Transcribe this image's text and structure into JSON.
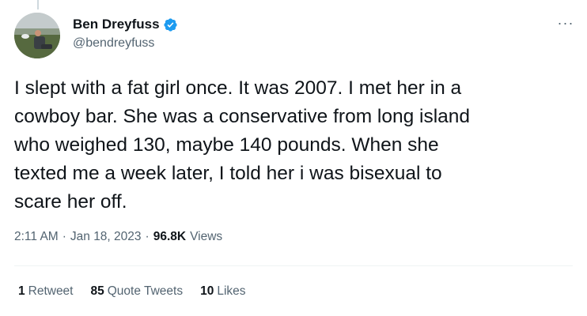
{
  "author": {
    "display_name": "Ben Dreyfuss",
    "handle": "@bendreyfuss",
    "verified_icon": "verified-badge-icon",
    "verified_color": "#1d9bf0"
  },
  "menu": {
    "more_label": "···"
  },
  "tweet": {
    "text": "I slept with a fat girl once. It was 2007. I met her in a\ncowboy bar. She was a conservative from long island\nwho weighed 130, maybe 140 pounds. When she\ntexted me a week later, I told her i was bisexual to\nscare her off."
  },
  "meta": {
    "time": "2:11 AM",
    "separator": "·",
    "date": "Jan 18, 2023",
    "views_count": "96.8K",
    "views_label": "Views"
  },
  "stats": {
    "retweets": {
      "count": "1",
      "label": "Retweet"
    },
    "quote_tweets": {
      "count": "85",
      "label": "Quote Tweets"
    },
    "likes": {
      "count": "10",
      "label": "Likes"
    }
  }
}
